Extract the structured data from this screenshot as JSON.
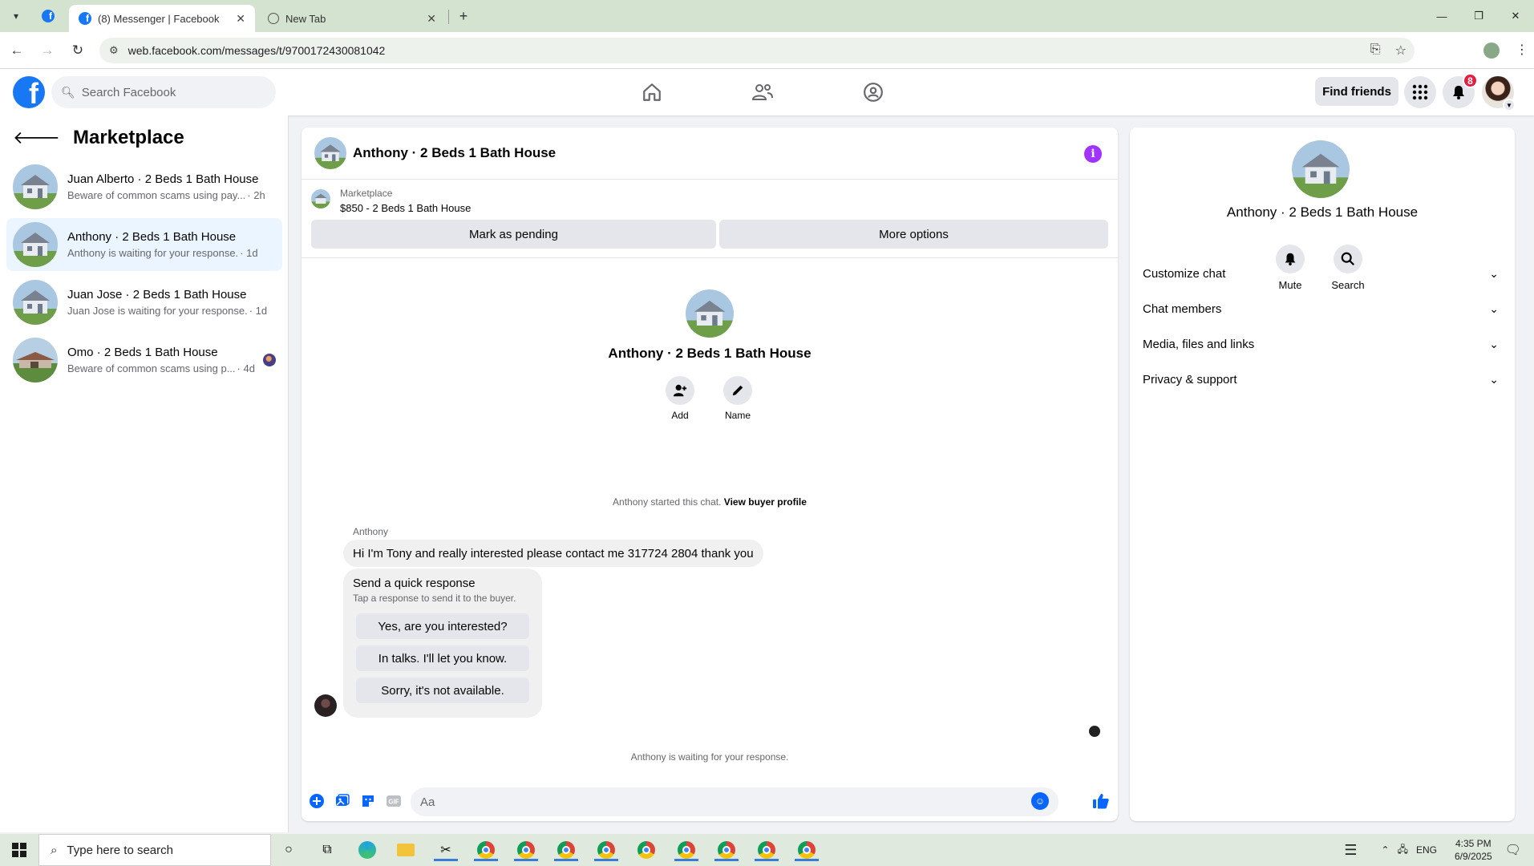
{
  "browser": {
    "tabs": [
      {
        "title": "(8) Messenger | Facebook",
        "active": true
      },
      {
        "title": "New Tab",
        "active": false
      }
    ],
    "url": "web.facebook.com/messages/t/9700172430081042"
  },
  "header": {
    "search_placeholder": "Search Facebook",
    "find_friends": "Find friends",
    "notification_count": "8"
  },
  "sidebar": {
    "title": "Marketplace",
    "conversations": [
      {
        "name": "Juan Alberto · 2 Beds 1 Bath House",
        "snippet": "Beware of common scams using pay...",
        "time": " · 2h",
        "active": false
      },
      {
        "name": "Anthony · 2 Beds 1 Bath House",
        "snippet": "Anthony is waiting for your response.",
        "time": " · 1d",
        "active": true
      },
      {
        "name": "Juan Jose · 2 Beds 1 Bath House",
        "snippet": "Juan Jose is waiting for your response.",
        "time": " · 1d",
        "active": false
      },
      {
        "name": "Omo · 2 Beds 1 Bath House",
        "snippet": "Beware of common scams using p...",
        "time": " · 4d",
        "active": false
      }
    ]
  },
  "chat": {
    "title": "Anthony · 2 Beds 1 Bath House",
    "listing_label": "Marketplace",
    "listing_price": "$850 - 2 Beds 1 Bath House",
    "mark_pending": "Mark as pending",
    "more_options": "More options",
    "intro_name": "Anthony · 2 Beds 1 Bath House",
    "add_label": "Add",
    "name_label": "Name",
    "started_text": "Anthony started this chat.",
    "view_profile": "View buyer profile",
    "sender": "Anthony",
    "message": "Hi I'm Tony and really interested please contact me 317724 2804 thank you",
    "quick_title": "Send a quick response",
    "quick_sub": "Tap a response to send it to the buyer.",
    "quick_responses": [
      "Yes, are you interested?",
      "In talks. I'll let you know.",
      "Sorry, it's not available."
    ],
    "waiting": "Anthony is waiting for your response.",
    "composer_placeholder": "Aa"
  },
  "info_panel": {
    "name": "Anthony · 2 Beds 1 Bath House",
    "mute": "Mute",
    "search": "Search",
    "sections": [
      "Customize chat",
      "Chat members",
      "Media, files and links",
      "Privacy & support"
    ]
  },
  "taskbar": {
    "search_placeholder": "Type here to search",
    "language": "ENG",
    "time": "4:35 PM",
    "date": "6/9/2025"
  },
  "colors": {
    "fb_blue": "#1877f2",
    "messenger_blue": "#0866ff",
    "info_purple": "#a033ff",
    "badge_red": "#e41e3f",
    "active_row": "#ebf5ff"
  }
}
